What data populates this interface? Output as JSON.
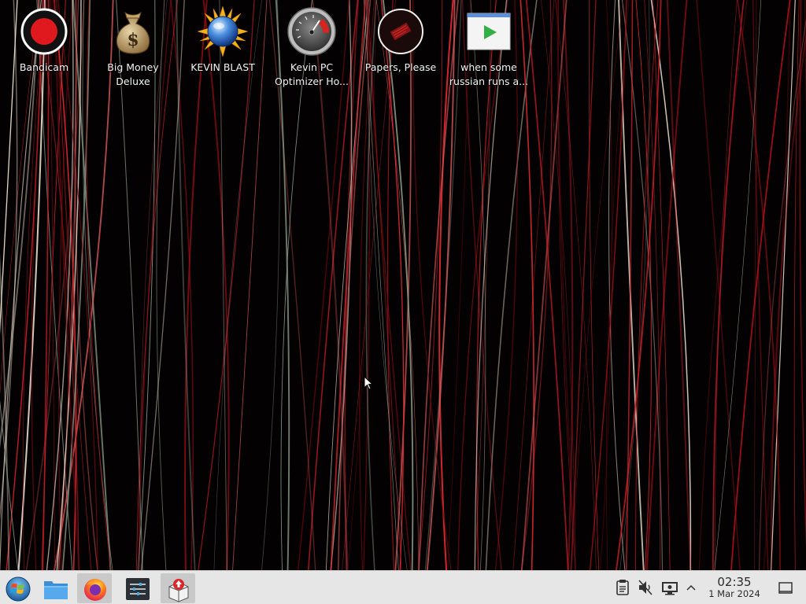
{
  "desktop": {
    "icons": [
      {
        "label": "Bandicam",
        "icon": "bandicam-record-icon"
      },
      {
        "label": "Big Money Deluxe",
        "icon": "money-bag-icon"
      },
      {
        "label": "KEVIN BLAST",
        "icon": "sun-globe-icon"
      },
      {
        "label": "Kevin PC Optimizer Ho...",
        "icon": "speedometer-gauge-icon"
      },
      {
        "label": "Papers, Please",
        "icon": "papers-please-seal-icon"
      },
      {
        "label": "when some russian runs a...",
        "icon": "video-play-window-icon"
      }
    ],
    "wallpaper": {
      "description_colors": [
        "#000000",
        "#c81e28",
        "#e8e0d0",
        "#8a9a88"
      ]
    }
  },
  "taskbar": {
    "launchers": [
      {
        "name": "start-menu",
        "icon": "windows-orb-icon"
      },
      {
        "name": "file-manager",
        "icon": "folder-icon"
      },
      {
        "name": "firefox",
        "icon": "firefox-icon"
      },
      {
        "name": "settings-mixer",
        "icon": "sliders-icon"
      },
      {
        "name": "package-installer",
        "icon": "package-box-icon"
      }
    ],
    "tray": {
      "icons": [
        "clipboard-icon",
        "volume-muted-icon",
        "display-icon",
        "chevron-up-icon"
      ],
      "clock": {
        "time": "02:35",
        "date": "1 Mar 2024"
      }
    }
  },
  "colors": {
    "taskbar_bg": "#e6e6e6",
    "accent_red": "#e0191f"
  }
}
